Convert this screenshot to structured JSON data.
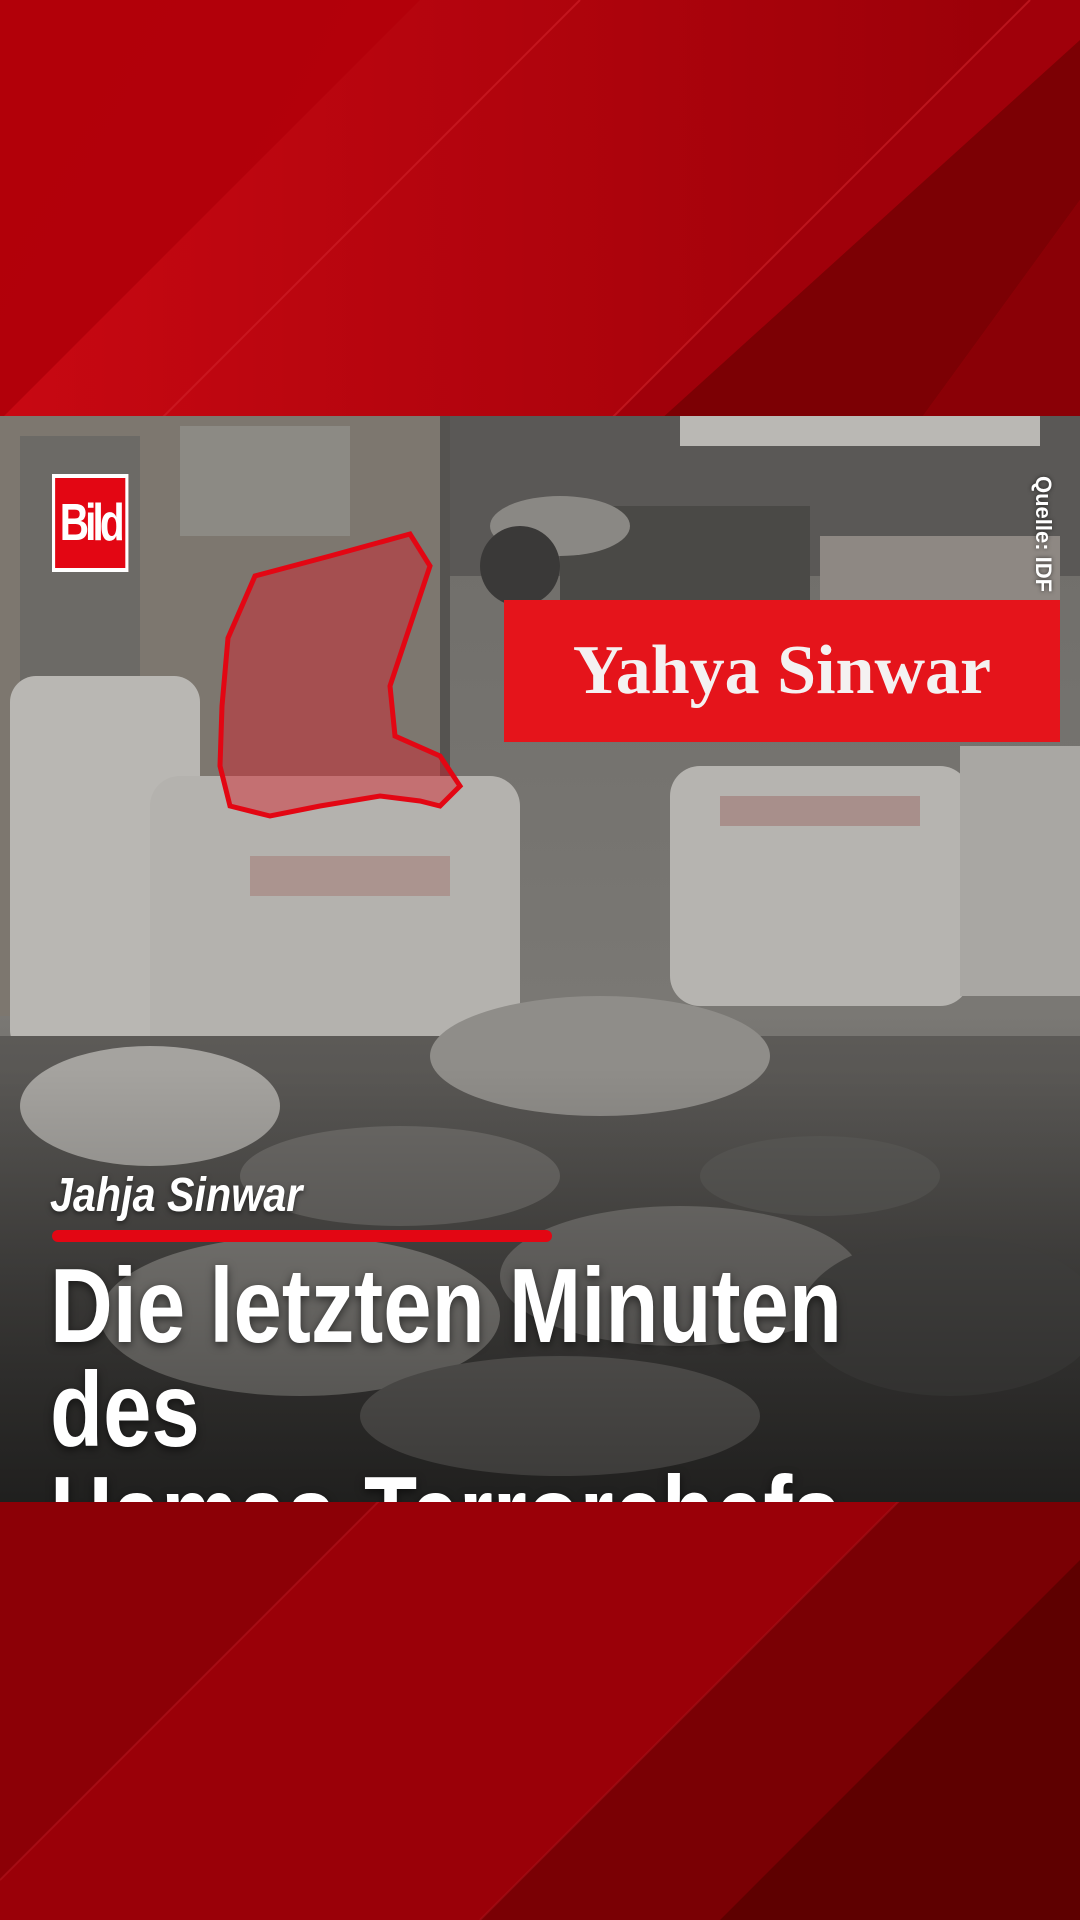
{
  "brand": {
    "logo_text": "Bild",
    "accent_color": "#e30613"
  },
  "video": {
    "source_credit": "Quelle: IDF",
    "name_label": "Yahya Sinwar",
    "kicker": "Jahja Sinwar",
    "headline_line1": "Die letzten Minuten des",
    "headline_line2": "Hamas-Terrorchefs"
  }
}
